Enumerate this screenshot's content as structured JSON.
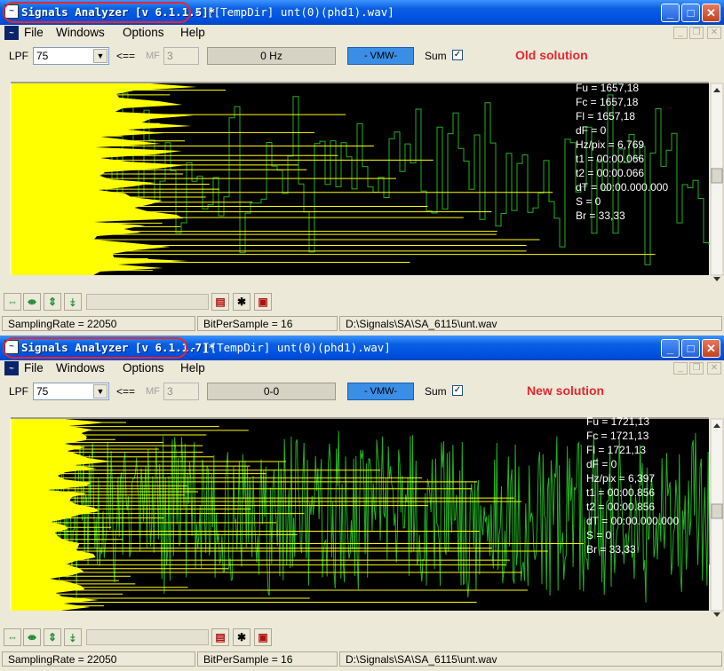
{
  "windows": [
    {
      "title": "Signals Analyzer [v 6.1.1.5]*",
      "subtitle": "- [[TempDir] unt(0)(phd1).wav]",
      "menu": [
        "File",
        "Windows",
        "Options",
        "Help"
      ],
      "toolbar": {
        "lpf_label": "LPF",
        "lpf_value": "75",
        "arrow_label": "<==",
        "mf_label": "MF",
        "mf_value": "3",
        "freq_value": "0 Hz",
        "vmw_label": "- VMW-",
        "sum_label": "Sum",
        "sum_check": "✓"
      },
      "annotation": "Old solution",
      "stats": [
        "Fu = 1657,18",
        "Fc = 1657,18",
        "Fl = 1657,18",
        "dF = 0",
        "Hz/pix = 6,769",
        "t1 = 00:00.066",
        "t2 = 00:00.066",
        "dT = 00:00.000.000",
        "S = 0",
        "Br = 33,33"
      ],
      "status": {
        "sampling_rate": "SamplingRate = 22050",
        "bits": "BitPerSample = 16",
        "path": "D:\\Signals\\SA\\SA_6115\\unt.wav"
      }
    },
    {
      "title": "Signals Analyzer [v 6.1.1.7]*",
      "subtitle": "- [[TempDir] unt(0)(phd1).wav]",
      "menu": [
        "File",
        "Windows",
        "Options",
        "Help"
      ],
      "toolbar": {
        "lpf_label": "LPF",
        "lpf_value": "75",
        "arrow_label": "<==",
        "mf_label": "MF",
        "mf_value": "3",
        "freq_value": "0-0",
        "vmw_label": "- VMW-",
        "sum_label": "Sum",
        "sum_check": "✓"
      },
      "annotation": "New solution",
      "stats": [
        "Fu = 1721,13",
        "Fc = 1721,13",
        "Fl = 1721,13",
        "dF = 0",
        "Hz/pix = 6,397",
        "t1 = 00:00.856",
        "t2 = 00:00.856",
        "dT = 00:00.000.000",
        "S = 0",
        "Br = 33,33"
      ],
      "status": {
        "sampling_rate": "SamplingRate = 22050",
        "bits": "BitPerSample = 16",
        "path": "D:\\Signals\\SA\\SA_6115\\unt.wav"
      }
    }
  ],
  "colors": {
    "plot_bg": "#000000",
    "spectrum": "#ffff00",
    "waveform": "#22b022",
    "title_accent": "#e8272d"
  },
  "icons": {
    "title": "signals-analyzer-app-icon",
    "buttons": [
      "horizontal-expand-icon",
      "horizontal-shrink-icon",
      "vertical-expand-icon",
      "vertical-shrink-icon",
      "spectrum-view-icon",
      "asterisk-icon",
      "save-icon"
    ]
  }
}
